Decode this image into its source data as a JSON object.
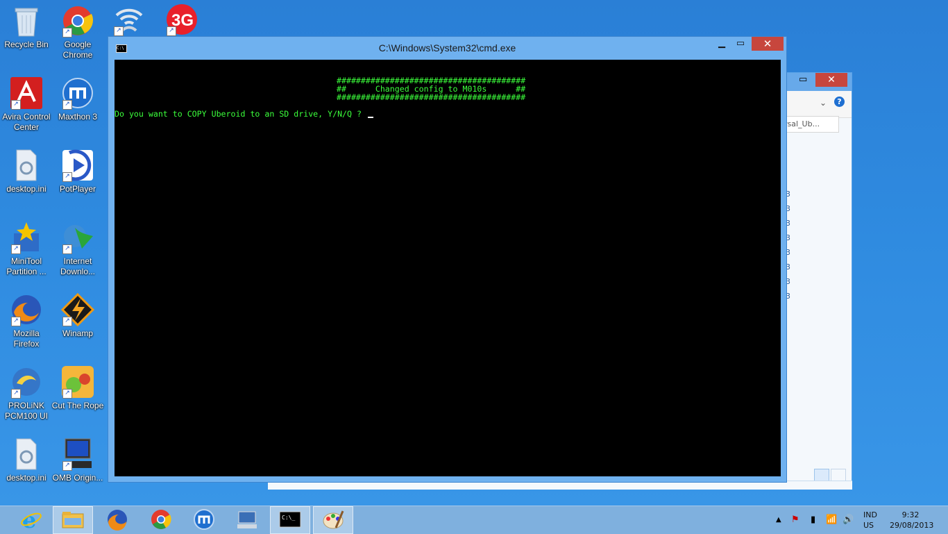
{
  "desktop_icons": [
    {
      "label": "Recycle Bin",
      "icon": "recycle-bin-icon"
    },
    {
      "label": "Google Chrome",
      "icon": "chrome-icon"
    },
    {
      "label": "",
      "icon": "wifi-icon"
    },
    {
      "label": "",
      "icon": "3g-icon"
    },
    {
      "label": "Avira Control Center",
      "icon": "avira-icon"
    },
    {
      "label": "Maxthon 3",
      "icon": "maxthon-icon"
    },
    {
      "label": "desktop.ini",
      "icon": "settings-file-icon"
    },
    {
      "label": "PotPlayer",
      "icon": "potplayer-icon"
    },
    {
      "label": "MiniTool Partition ...",
      "icon": "minitool-icon"
    },
    {
      "label": "Internet Downlo...",
      "icon": "idm-icon"
    },
    {
      "label": "Mozilla Firefox",
      "icon": "firefox-icon"
    },
    {
      "label": "Winamp",
      "icon": "winamp-icon"
    },
    {
      "label": "PROLiNK PCM100 UI",
      "icon": "prolink-icon"
    },
    {
      "label": "Cut The Rope",
      "icon": "cut-the-rope-icon"
    },
    {
      "label": "desktop.ini",
      "icon": "settings-file-icon"
    },
    {
      "label": "OMB Origin...",
      "icon": "computer-icon"
    }
  ],
  "cmd": {
    "title": "C:\\Windows\\System32\\cmd.exe",
    "close": "✕",
    "lines": [
      "#######################################",
      "##      Changed config to M010s      ##",
      "#######################################",
      "Do you want to COPY Uberoid to an SD drive, Y/N/Q ? "
    ]
  },
  "explorer": {
    "address": "rsal_Ub...",
    "row_marks": [
      "3",
      "3",
      "3",
      "3",
      "3",
      "3",
      "3",
      "3"
    ]
  },
  "taskbar": {
    "pinned": [
      "ie-icon",
      "file-explorer-icon",
      "firefox-icon",
      "chrome-icon",
      "maxthon-icon",
      "network-icon",
      "cmd-icon",
      "paint-icon"
    ],
    "language": {
      "code": "IND",
      "region": "US"
    },
    "clock": {
      "time": "9:32",
      "date": "29/08/2013"
    }
  }
}
